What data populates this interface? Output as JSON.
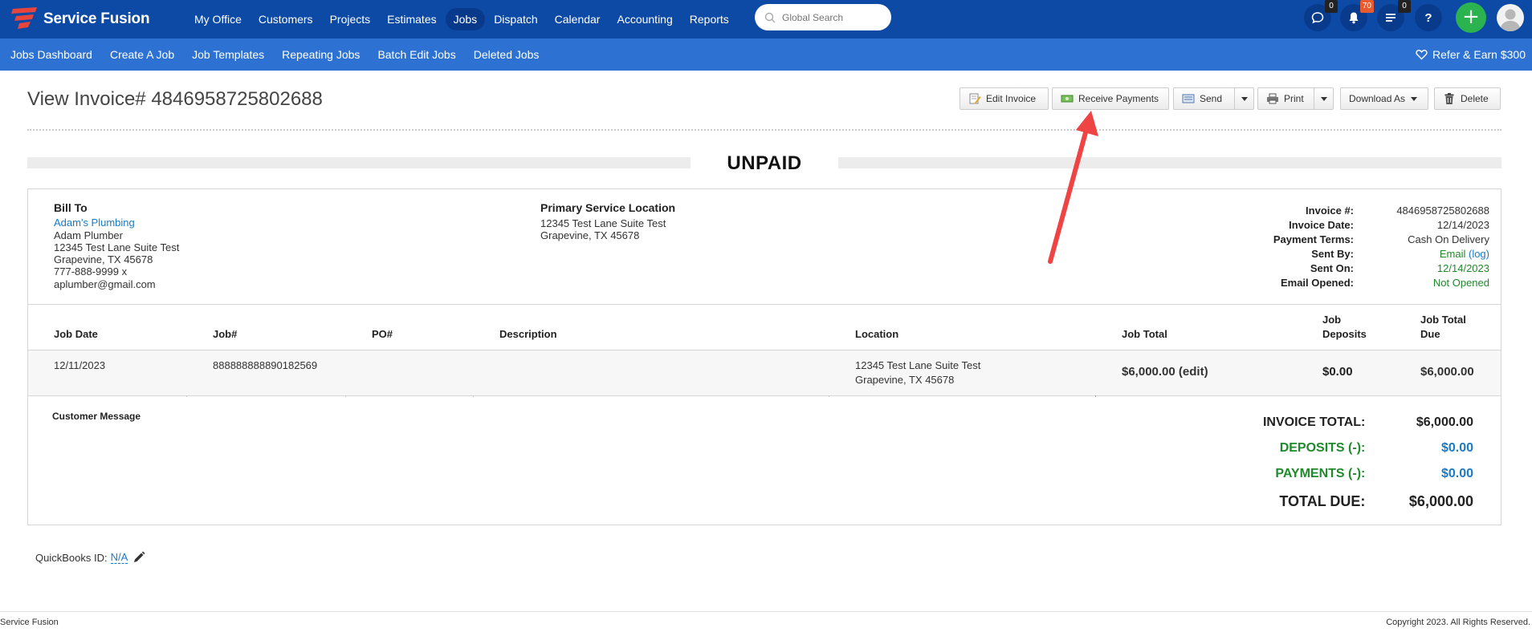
{
  "app": {
    "name": "Service Fusion"
  },
  "nav": {
    "items": [
      "My Office",
      "Customers",
      "Projects",
      "Estimates",
      "Jobs",
      "Dispatch",
      "Calendar",
      "Accounting",
      "Reports"
    ],
    "active": "Jobs",
    "search_placeholder": "Global Search",
    "badges": {
      "chat": "0",
      "notifications": "70",
      "tasks": "0"
    },
    "help_label": "?",
    "add_label": "+"
  },
  "subnav": {
    "items": [
      "Jobs Dashboard",
      "Create A Job",
      "Job Templates",
      "Repeating Jobs",
      "Batch Edit Jobs",
      "Deleted Jobs"
    ],
    "refer_label": "Refer & Earn $300"
  },
  "page": {
    "title": "View Invoice# 4846958725802688",
    "status": "UNPAID"
  },
  "toolbar": {
    "edit_invoice": "Edit Invoice",
    "receive_payments": "Receive Payments",
    "send": "Send",
    "print": "Print",
    "download_as": "Download As",
    "delete": "Delete"
  },
  "bill_to": {
    "heading": "Bill To",
    "company": "Adam's Plumbing",
    "contact": "Adam Plumber",
    "street": "12345 Test Lane Suite Test",
    "city": "Grapevine, TX 45678",
    "phone": "777-888-9999 x",
    "email": "aplumber@gmail.com"
  },
  "service_location": {
    "heading": "Primary Service Location",
    "street": "12345 Test Lane Suite Test",
    "city": "Grapevine, TX 45678"
  },
  "invoice_meta": {
    "invoice_no_label": "Invoice #:",
    "invoice_no": "4846958725802688",
    "date_label": "Invoice Date:",
    "date": "12/14/2023",
    "terms_label": "Payment Terms:",
    "terms": "Cash On Delivery",
    "sent_by_label": "Sent By:",
    "sent_by": "Email",
    "sent_by_log": "(log)",
    "sent_on_label": "Sent On:",
    "sent_on": "12/14/2023",
    "opened_label": "Email Opened:",
    "opened": "Not Opened"
  },
  "table": {
    "headers": {
      "job_date": "Job Date",
      "job_no": "Job#",
      "po_no": "PO#",
      "description": "Description",
      "location": "Location",
      "job_total": "Job Total",
      "job_deposits_1": "Job",
      "job_deposits_2": "Deposits",
      "job_total_due_1": "Job Total",
      "job_total_due_2": "Due"
    },
    "row": {
      "job_date": "12/11/2023",
      "job_no": "888888888890182569",
      "po_no": "",
      "description": "",
      "location_1": "12345 Test Lane Suite Test",
      "location_2": "Grapevine, TX 45678",
      "job_total": "$6,000.00",
      "job_total_edit": "(edit)",
      "job_deposits": "$0.00",
      "job_total_due": "$6,000.00"
    }
  },
  "customer_message": {
    "label": "Customer Message"
  },
  "totals": {
    "invoice_total_label": "INVOICE TOTAL:",
    "invoice_total": "$6,000.00",
    "deposits_label": "DEPOSITS (-):",
    "deposits": "$0.00",
    "payments_label": "PAYMENTS (-):",
    "payments": "$0.00",
    "total_due_label": "TOTAL DUE:",
    "total_due": "$6,000.00"
  },
  "quickbooks": {
    "label": "QuickBooks ID:",
    "value": "N/A"
  },
  "footer": {
    "left": "Service Fusion",
    "right": "Copyright 2023. All Rights Reserved."
  },
  "colors": {
    "topbar": "#0c4aa6",
    "subbar": "#2d72d2",
    "link": "#1a7ac5",
    "green": "#1f8a2b",
    "add_button": "#2bb34f",
    "annotation_arrow": "#ee4444"
  }
}
